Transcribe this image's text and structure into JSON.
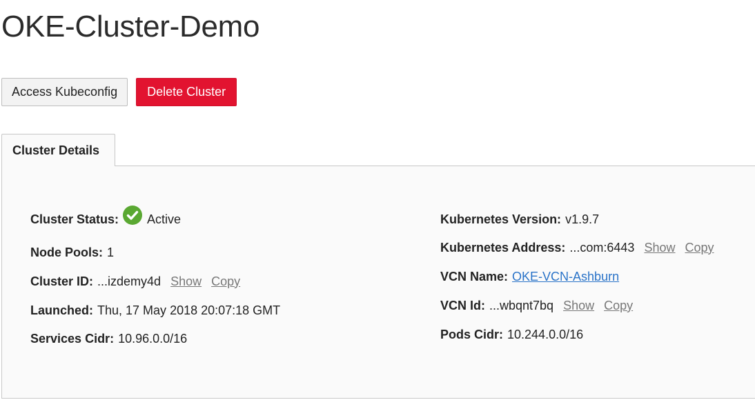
{
  "page": {
    "title": "OKE-Cluster-Demo"
  },
  "actions": {
    "access_kubeconfig": "Access Kubeconfig",
    "delete_cluster": "Delete Cluster"
  },
  "tabs": [
    {
      "label": "Cluster Details",
      "active": true
    }
  ],
  "details": {
    "left": {
      "cluster_status": {
        "label": "Cluster Status:",
        "value": "Active",
        "icon": "check-circle-icon"
      },
      "node_pools": {
        "label": "Node Pools:",
        "value": "1"
      },
      "cluster_id": {
        "label": "Cluster ID:",
        "value": "...izdemy4d",
        "show": "Show",
        "copy": "Copy"
      },
      "launched": {
        "label": "Launched:",
        "value": "Thu, 17 May 2018 20:07:18 GMT"
      },
      "services_cidr": {
        "label": "Services Cidr:",
        "value": "10.96.0.0/16"
      }
    },
    "right": {
      "kubernetes_version": {
        "label": "Kubernetes Version:",
        "value": "v1.9.7"
      },
      "kubernetes_address": {
        "label": "Kubernetes Address:",
        "value": "...com:6443",
        "show": "Show",
        "copy": "Copy"
      },
      "vcn_name": {
        "label": "VCN Name:",
        "value": "OKE-VCN-Ashburn"
      },
      "vcn_id": {
        "label": "VCN Id:",
        "value": "...wbqnt7bq",
        "show": "Show",
        "copy": "Copy"
      },
      "pods_cidr": {
        "label": "Pods Cidr:",
        "value": "10.244.0.0/16"
      }
    }
  },
  "colors": {
    "danger": "#e21330",
    "status_active": "#5aa832",
    "link": "#2a73c8"
  }
}
